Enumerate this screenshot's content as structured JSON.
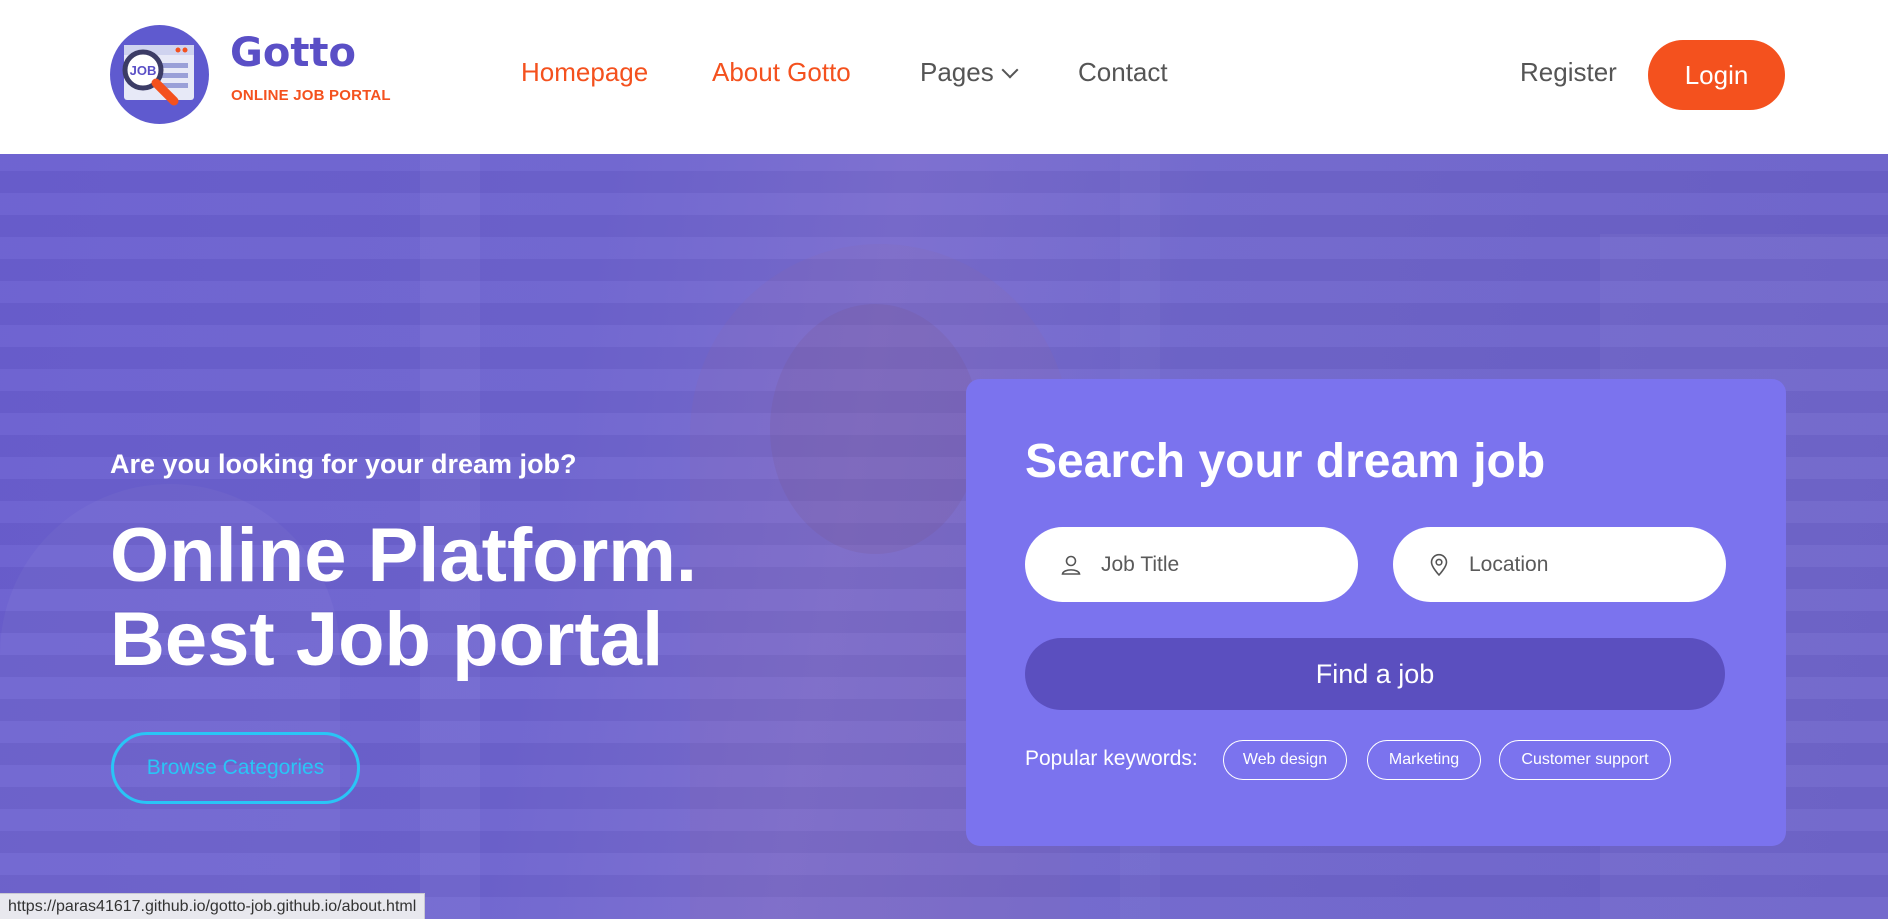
{
  "header": {
    "logo_title": "Gotto",
    "logo_subtitle": "ONLINE JOB PORTAL",
    "logo_badge": "JOB",
    "nav": [
      {
        "label": "Homepage",
        "active": true
      },
      {
        "label": "About Gotto",
        "active": true
      },
      {
        "label": "Pages",
        "has_dropdown": true
      },
      {
        "label": "Contact"
      }
    ],
    "register_label": "Register",
    "login_label": "Login"
  },
  "hero": {
    "eyebrow": "Are you looking for your dream job?",
    "title_line1": "Online Platform.",
    "title_line2": "Best Job portal",
    "browse_label": "Browse Categories"
  },
  "search": {
    "title": "Search your dream job",
    "job_placeholder": "Job Title",
    "location_placeholder": "Location",
    "find_label": "Find a job",
    "popular_label": "Popular keywords:",
    "keywords": [
      "Web design",
      "Marketing",
      "Customer support"
    ]
  },
  "status_bar": {
    "url": "https://paras41617.github.io/gotto-job.github.io/about.html"
  },
  "colors": {
    "brand_purple": "#5a4fc6",
    "accent_orange": "#f4511e",
    "card_purple": "#7b73ee",
    "button_purple": "#5b4fbf",
    "browse_cyan": "#29c5f6"
  },
  "icons": {
    "job_field": "user-icon",
    "location_field": "map-pin-icon",
    "pages_dropdown": "chevron-down-icon",
    "logo": "job-search-magnifier-icon"
  }
}
